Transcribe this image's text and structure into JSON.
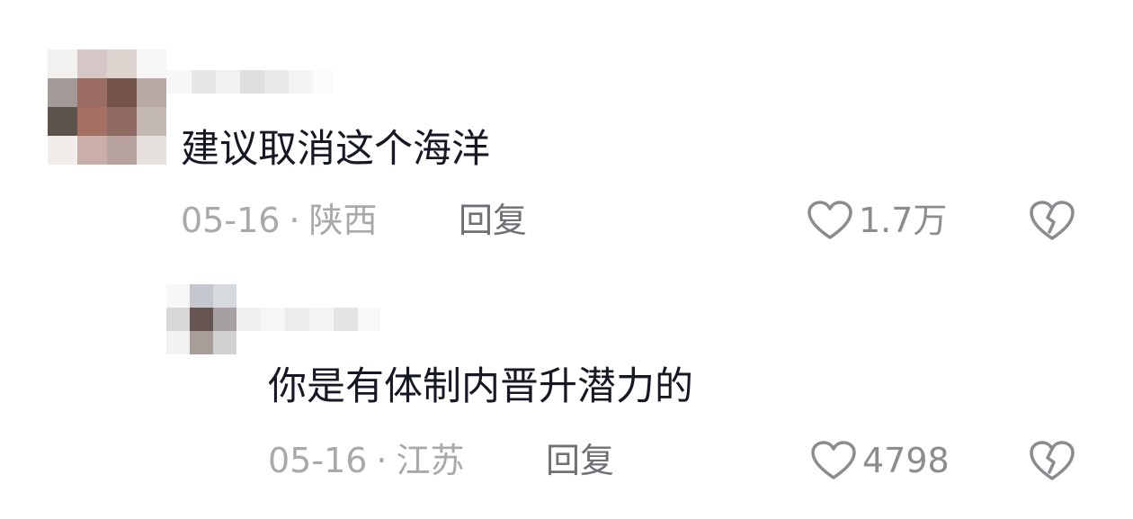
{
  "colors": {
    "text": "#161823",
    "meta": "#a9a9ad",
    "reply": "#6f6f75",
    "icon": "#8b8b90"
  },
  "comments": [
    {
      "text": "建议取消这个海洋",
      "date": "05-16",
      "separator": "·",
      "location": "陕西",
      "reply_label": "回复",
      "likes": "1.7万",
      "like_icon": "heart-outline-icon",
      "dislike_icon": "broken-heart-icon"
    },
    {
      "text": "你是有体制内晋升潜力的",
      "date": "05-16",
      "separator": "·",
      "location": "江苏",
      "reply_label": "回复",
      "likes": "4798",
      "like_icon": "heart-outline-icon",
      "dislike_icon": "broken-heart-icon"
    }
  ]
}
